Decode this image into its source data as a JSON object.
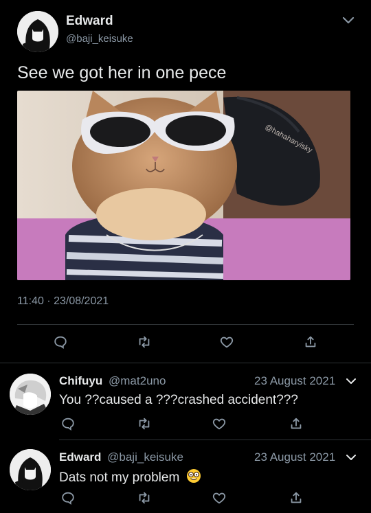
{
  "tweet": {
    "author_name": "Edward",
    "author_handle": "@baji_keisuke",
    "text": "See we got her in one pece",
    "timestamp": "11:40 · 23/08/2021",
    "image_watermark": "@hahaharyisky"
  },
  "replies": [
    {
      "author_name": "Chifuyu",
      "author_handle": "@mat2uno",
      "date": "23 August 2021",
      "text": "You ??caused a ???crashed accident???"
    },
    {
      "author_name": "Edward",
      "author_handle": "@baji_keisuke",
      "date": "23 August 2021",
      "text": "Dats not my problem",
      "emoji": "nerd-face"
    }
  ],
  "icons": {
    "reply": "speech-bubble-icon",
    "retweet": "retweet-icon",
    "like": "heart-icon",
    "share": "share-icon",
    "menu": "chevron-down-icon"
  },
  "colors": {
    "background": "#000000",
    "text": "#e7e9ea",
    "muted": "#8b98a5",
    "divider": "#2f3336"
  }
}
